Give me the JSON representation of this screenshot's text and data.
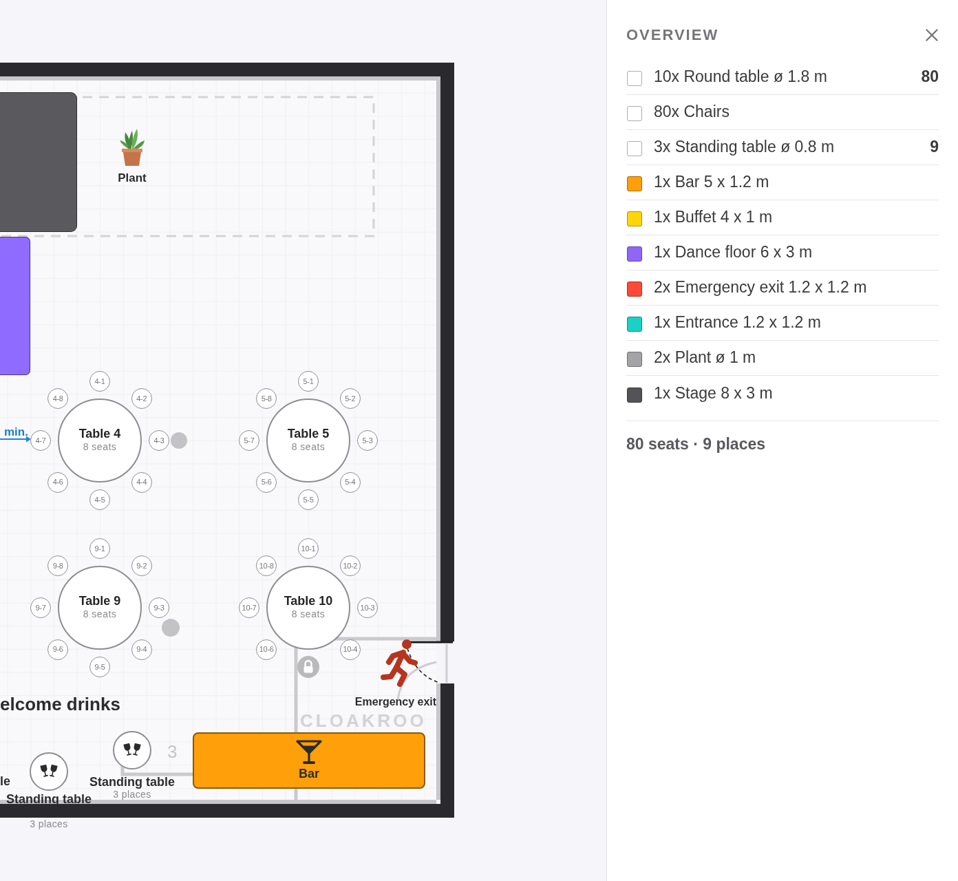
{
  "floor_plan": {
    "plant": {
      "label": "Plant"
    },
    "measure": {
      "label": "min."
    },
    "tables": [
      {
        "name": "Table 4",
        "seats_label": "8 seats",
        "locked": false,
        "seats": [
          "4-1",
          "4-2",
          "4-3",
          "4-4",
          "4-5",
          "4-6",
          "4-7",
          "4-8"
        ]
      },
      {
        "name": "Table 5",
        "seats_label": "8 seats",
        "locked": false,
        "seats": [
          "5-1",
          "5-2",
          "5-3",
          "5-4",
          "5-5",
          "5-6",
          "5-7",
          "5-8"
        ]
      },
      {
        "name": "Table 9",
        "seats_label": "8 seats",
        "locked": false,
        "seats": [
          "9-1",
          "9-2",
          "9-3",
          "9-4",
          "9-5",
          "9-6",
          "9-7",
          "9-8"
        ]
      },
      {
        "name": "Table 10",
        "seats_label": "8 seats",
        "locked": true,
        "seats": [
          "10-1",
          "10-2",
          "10-3",
          "10-4",
          "10-6",
          "10-7",
          "10-8"
        ]
      }
    ],
    "emergency_exit": {
      "label": "Emergency exit"
    },
    "zone_label": "elcome drinks",
    "room_label": "CLOAKROO",
    "dimension_label": "3",
    "standing_tables": [
      {
        "name": "Standing table",
        "places": "3 places"
      },
      {
        "name": "Standing table",
        "places": "3 places"
      }
    ],
    "partial_label": "le",
    "bar": {
      "label": "Bar"
    }
  },
  "overview": {
    "title": "OVERVIEW",
    "items": [
      {
        "label": "10x Round table ø 1.8 m",
        "color": "#ffffff",
        "count": "80"
      },
      {
        "label": "80x Chairs",
        "color": "#ffffff"
      },
      {
        "label": "3x Standing table ø 0.8 m",
        "color": "#ffffff",
        "count": "9"
      },
      {
        "label": "1x Bar 5 x 1.2 m",
        "color": "#ff9f0a"
      },
      {
        "label": "1x Buffet 4 x 1 m",
        "color": "#ffd60a"
      },
      {
        "label": "1x Dance floor 6 x 3 m",
        "color": "#8e67f7"
      },
      {
        "label": "2x Emergency exit 1.2 x 1.2 m",
        "color": "#fe4a36"
      },
      {
        "label": "1x Entrance 1.2 x 1.2 m",
        "color": "#19d2c5"
      },
      {
        "label": "2x Plant ø 1 m",
        "color": "#a3a3a8"
      },
      {
        "label": "1x Stage 8 x 3 m",
        "color": "#545458"
      }
    ],
    "summary": "80 seats · 9 places"
  }
}
